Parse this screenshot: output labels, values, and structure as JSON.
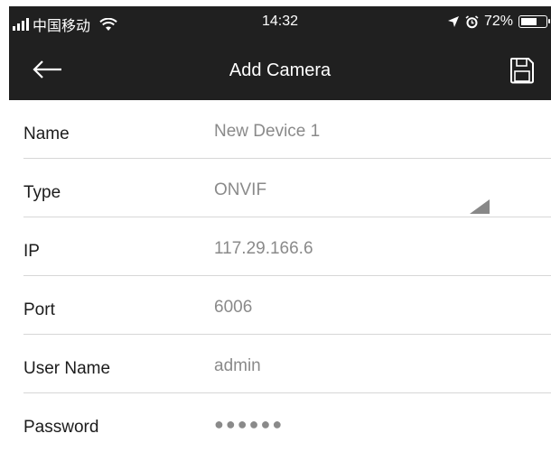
{
  "status_bar": {
    "carrier": "中国移动",
    "time": "14:32",
    "battery": "72%",
    "battery_level": 0.72,
    "icons": [
      "signal-bars-icon",
      "wifi-icon",
      "location-arrow-icon",
      "alarm-icon",
      "battery-icon"
    ]
  },
  "header": {
    "title": "Add Camera",
    "back_icon": "back-arrow-icon",
    "save_icon": "floppy-disk-icon",
    "background": "#202020"
  },
  "form": {
    "fields": [
      {
        "label": "Name",
        "value": "New Device 1"
      },
      {
        "label": "Type",
        "value": "ONVIF"
      },
      {
        "label": "IP",
        "value": "117.29.166.6"
      },
      {
        "label": "Port",
        "value": "6006"
      },
      {
        "label": "User Name",
        "value": "admin"
      },
      {
        "label": "Password",
        "value": "●●●●●●"
      }
    ]
  }
}
